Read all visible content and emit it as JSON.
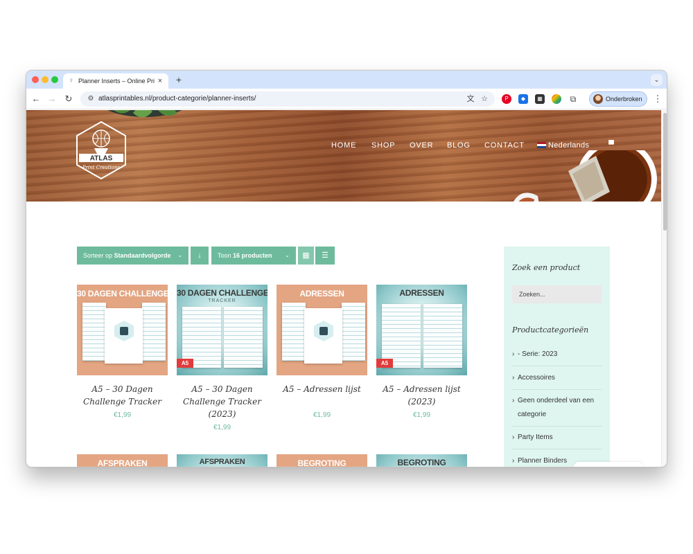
{
  "browser": {
    "tab_title": "Planner Inserts – Online Printables",
    "tab_close": "×",
    "new_tab": "+",
    "tab_list": "⌄",
    "url": "atlasprintables.nl/product-categorie/planner-inserts/",
    "profile_label": "Onderbroken",
    "back": "←",
    "forward": "→",
    "reload": "↻",
    "star": "☆",
    "translate": "文",
    "menu": "⋮"
  },
  "header": {
    "logo_text": "ATLAS",
    "logo_subtext": "Print Creations",
    "nav": [
      "HOME",
      "SHOP",
      "OVER",
      "BLOG",
      "CONTACT"
    ],
    "language": "Nederlands",
    "cart_icon": "cart-icon"
  },
  "controls": {
    "sort_prefix": "Sorteer op ",
    "sort_value": "Standaardvolgorde",
    "sort_direction": "↓",
    "count_prefix": "Toon ",
    "count_value": "16 producten",
    "grid_icon": "grid-icon",
    "list_icon": "list-icon"
  },
  "products": [
    {
      "thumb_title": "30 DAGEN CHALLENGE",
      "thumb_sub": "",
      "style": "orange",
      "ribbon": "",
      "title": "A5 – 30 Dagen Challenge Tracker",
      "price": "€1,99"
    },
    {
      "thumb_title": "30 DAGEN CHALLENGE",
      "thumb_sub": "TRACKER",
      "style": "teal",
      "ribbon": "A5",
      "title": "A5 – 30 Dagen Challenge Tracker (2023)",
      "price": "€1,99"
    },
    {
      "thumb_title": "ADRESSEN",
      "thumb_sub": "",
      "style": "orange",
      "ribbon": "",
      "title": "A5 – Adressen lijst",
      "price": "€1,99"
    },
    {
      "thumb_title": "ADRESSEN",
      "thumb_sub": "",
      "style": "teal",
      "ribbon": "A5",
      "title": "A5 – Adressen lijst (2023)",
      "price": "€1,99"
    }
  ],
  "products_row2": [
    {
      "thumb_title": "AFSPRAKEN",
      "style": "orange"
    },
    {
      "thumb_title": "AFSPRAKEN",
      "style": "teal"
    },
    {
      "thumb_title": "BEGROTING",
      "style": "orange"
    },
    {
      "thumb_title": "BEGROTING",
      "style": "teal"
    }
  ],
  "sidebar": {
    "search_heading": "Zoek een product",
    "search_placeholder": "Zoeken...",
    "categories_heading": "Productcategorieën",
    "categories": [
      "- Serie: 2023",
      "Accessoires",
      "Geen onderdeel van een categorie",
      "Party Items",
      "Planner Binders"
    ]
  },
  "colors": {
    "accent": "#6dbb9c",
    "sidebar_bg": "#dff5ef",
    "tabstrip": "#d3e3fb"
  }
}
